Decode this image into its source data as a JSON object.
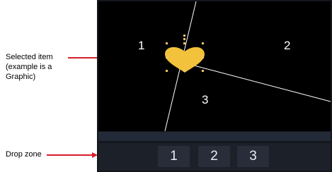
{
  "annotations": {
    "selected_item": "Selected item (example is a Graphic)",
    "drop_zone": "Drop zone"
  },
  "stage": {
    "regions": [
      "1",
      "2",
      "3"
    ]
  },
  "drop_zone": {
    "slots": [
      "1",
      "2",
      "3"
    ]
  },
  "colors": {
    "annotation_arrow": "#d81e2c",
    "stage_background": "#000000",
    "heart": "#f2c23c",
    "selection_handle": "#f0c46a",
    "divider_line": "#ffffff",
    "drop_zone_background": "#1b2029",
    "drop_slot_background": "#272d39"
  },
  "icons": {
    "selected_graphic": "heart-icon",
    "arrow": "arrow-right-icon"
  }
}
